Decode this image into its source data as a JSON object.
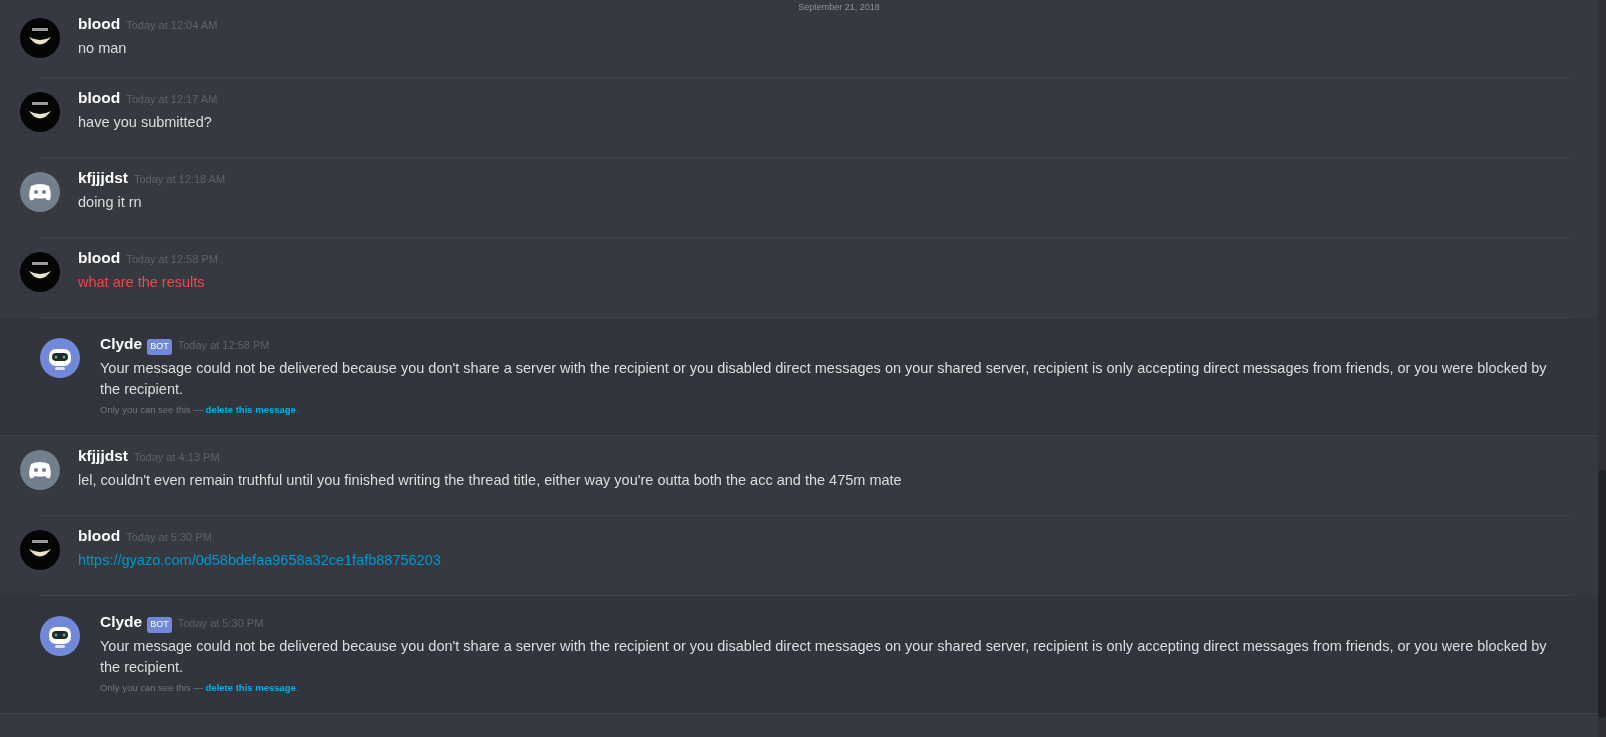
{
  "date_divider": "September 21, 2018",
  "messages": [
    {
      "kind": "user",
      "author": "blood",
      "avatar": {
        "kind": "grin"
      },
      "timestamp": "Today at 12:04 AM",
      "text": "no man",
      "failed": false,
      "link": false
    },
    {
      "kind": "user",
      "author": "blood",
      "avatar": {
        "kind": "grin"
      },
      "timestamp": "Today at 12:17 AM",
      "text": "have you submitted?",
      "failed": false,
      "link": false
    },
    {
      "kind": "user",
      "author": "kfjjjdst",
      "avatar": {
        "kind": "default"
      },
      "timestamp": "Today at 12:18 AM",
      "text": "doing it rn",
      "failed": false,
      "link": false
    },
    {
      "kind": "user",
      "author": "blood",
      "avatar": {
        "kind": "grin"
      },
      "timestamp": "Today at 12:58 PM",
      "text": "what are the results",
      "failed": true,
      "link": false
    },
    {
      "kind": "bot",
      "author": "Clyde",
      "badge": "BOT",
      "avatar": {
        "kind": "robot"
      },
      "timestamp": "Today at 12:58 PM",
      "text": "Your message could not be delivered because you don't share a server with the recipient or you disabled direct messages on your shared server, recipient is only accepting direct messages from friends, or you were blocked by the recipient.",
      "note": "Only you can see this —",
      "note_link": "delete this message",
      "note_end": "."
    },
    {
      "kind": "user",
      "author": "kfjjjdst",
      "avatar": {
        "kind": "default"
      },
      "timestamp": "Today at 4:13 PM",
      "text": "lel, couldn't even remain truthful until you finished writing the thread title, either way you're outta both the acc and the 475m mate",
      "failed": false,
      "link": false
    },
    {
      "kind": "user",
      "author": "blood",
      "avatar": {
        "kind": "grin"
      },
      "timestamp": "Today at 5:30 PM",
      "text": "https://gyazo.com/0d58bdefaa9658a32ce1fafb88756203",
      "failed": false,
      "link": true
    },
    {
      "kind": "bot",
      "author": "Clyde",
      "badge": "BOT",
      "avatar": {
        "kind": "robot"
      },
      "timestamp": "Today at 5:30 PM",
      "text": "Your message could not be delivered because you don't share a server with the recipient or you disabled direct messages on your shared server, recipient is only accepting direct messages from friends, or you were blocked by the recipient.",
      "note": "Only you can see this —",
      "note_link": "delete this message",
      "note_end": "."
    }
  ]
}
